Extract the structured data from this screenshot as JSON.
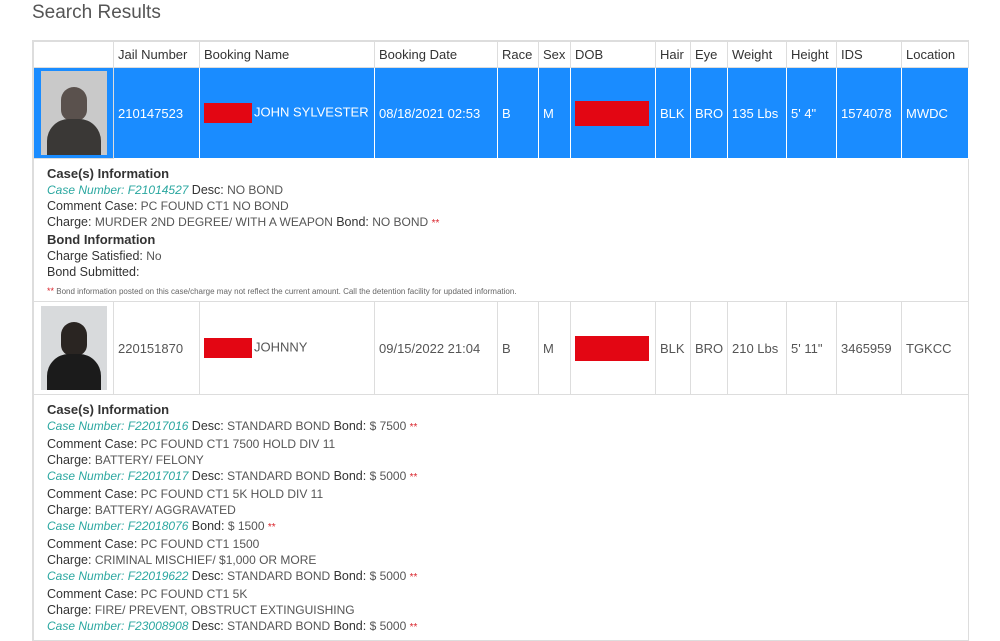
{
  "page": {
    "title": "Search Results"
  },
  "table": {
    "headers": [
      "",
      "Jail Number",
      "Booking Name",
      "Booking Date",
      "Race",
      "Sex",
      "DOB",
      "Hair",
      "Eye",
      "Weight",
      "Height",
      "IDS",
      "Location"
    ]
  },
  "inmates": [
    {
      "jail_number": "210147523",
      "booking_name": "JOHN SYLVESTER",
      "booking_date": "08/18/2021 02:53",
      "race": "B",
      "sex": "M",
      "hair": "BLK",
      "eye": "BRO",
      "weight": "135 Lbs",
      "height": "5' 4\"",
      "ids": "1574078",
      "location": "MWDC",
      "cases_heading": "Case(s) Information",
      "case1": {
        "case_label": "Case Number:",
        "case_number": "F21014527",
        "desc_label": "Desc:",
        "desc": "NO BOND",
        "comment_label": "Comment Case:",
        "comment": "PC FOUND CT1 NO BOND",
        "charge_label": "Charge:",
        "charge": "MURDER 2ND DEGREE/ WITH A WEAPON",
        "bond_label": "Bond:",
        "bond": "NO BOND",
        "star": "**"
      },
      "bond_heading": "Bond Information",
      "charge_satisfied_label": "Charge Satisfied:",
      "charge_satisfied": "No",
      "bond_submitted_label": "Bond Submitted:",
      "footnote_star": "**",
      "footnote": "Bond information posted on this case/charge may not reflect the current amount. Call the detention facility for updated information."
    },
    {
      "jail_number": "220151870",
      "booking_name": "JOHNNY",
      "booking_date": "09/15/2022 21:04",
      "race": "B",
      "sex": "M",
      "hair": "BLK",
      "eye": "BRO",
      "weight": "210 Lbs",
      "height": "5' 11\"",
      "ids": "3465959",
      "location": "TGKCC",
      "cases_heading": "Case(s) Information",
      "cases": [
        {
          "case_label": "Case Number:",
          "case_number": "F22017016",
          "desc_label": "Desc:",
          "desc": "STANDARD BOND",
          "bond_label": "Bond:",
          "bond": "$ 7500",
          "star": "**",
          "comment_label": "Comment Case:",
          "comment": "PC FOUND CT1 7500 HOLD DIV 11",
          "charge_label": "Charge:",
          "charge": "BATTERY/ FELONY"
        },
        {
          "case_label": "Case Number:",
          "case_number": "F22017017",
          "desc_label": "Desc:",
          "desc": "STANDARD BOND",
          "bond_label": "Bond:",
          "bond": "$ 5000",
          "star": "**",
          "comment_label": "Comment Case:",
          "comment": "PC FOUND CT1 5K HOLD DIV 11",
          "charge_label": "Charge:",
          "charge": "BATTERY/ AGGRAVATED"
        },
        {
          "case_label": "Case Number:",
          "case_number": "F22018076",
          "bond_label": "Bond:",
          "bond": "$ 1500",
          "star": "**",
          "comment_label": "Comment Case:",
          "comment": "PC FOUND CT1 1500",
          "charge_label": "Charge:",
          "charge": "CRIMINAL MISCHIEF/ $1,000 OR MORE"
        },
        {
          "case_label": "Case Number:",
          "case_number": "F22019622",
          "desc_label": "Desc:",
          "desc": "STANDARD BOND",
          "bond_label": "Bond:",
          "bond": "$ 5000",
          "star": "**",
          "comment_label": "Comment Case:",
          "comment": "PC FOUND CT1 5K",
          "charge_label": "Charge:",
          "charge": "FIRE/ PREVENT, OBSTRUCT EXTINGUISHING"
        },
        {
          "case_label": "Case Number:",
          "case_number": "F23008908",
          "desc_label": "Desc:",
          "desc": "STANDARD BOND",
          "bond_label": "Bond:",
          "bond": "$ 5000",
          "star": "**"
        }
      ]
    }
  ],
  "colors": {
    "selected_row": "#1a8cff",
    "case_link": "#2aa7a0",
    "redaction": "#e30613",
    "required_star": "#d9222a"
  }
}
